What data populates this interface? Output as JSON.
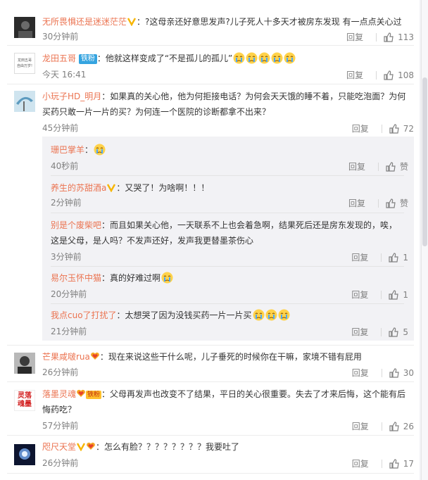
{
  "comments": [
    {
      "user": "无所畏惧还是迷迷茫茫",
      "text": "：?这母亲还好意思发声?儿子死人十多天才被房东发现 有一点点关心过",
      "time": "30分钟前",
      "reply": "回复",
      "likes": "113"
    },
    {
      "user": "龙田五哥",
      "badge": "铁粉",
      "text": "：他就这样变成了“不是孤儿的孤儿”",
      "time": "今天 16:41",
      "reply": "回复",
      "likes": "108",
      "avatar_text": [
        "龙田五哥",
        "自由万岁!"
      ]
    },
    {
      "user": "小玩子HD_明月",
      "text_lines": [
        "：如果真的关心他，他为何拒接电话？为何会天天饿的睡不着，只能吃泡面？为何",
        "买药只敢一片一片的买？为何连一个医院的诊断都拿不出来？"
      ],
      "time": "45分钟前",
      "reply": "回复",
      "likes": "72"
    }
  ],
  "replies": [
    {
      "user": "珊巴掌羊",
      "text": "：",
      "time": "40秒前",
      "reply": "回复",
      "likes": "赞"
    },
    {
      "user": "养生的苏甜酒a",
      "text": "：又哭了！为啥啊！！！",
      "time": "2分钟前",
      "reply": "回复",
      "likes": "赞"
    },
    {
      "user": "别是个废柴吧",
      "text_lines": [
        "：而且如果关心他，一天联系不上也会着急啊，结果死后还是房东发现的，唉，",
        "这是父母，是人吗？不发声还好，发声我更替墨茶伤心"
      ],
      "time": "3分钟前",
      "reply": "回复",
      "likes": "1"
    },
    {
      "user": "易尔玉怀中猫",
      "text": "：真的好难过啊",
      "time": "20分钟前",
      "reply": "回复",
      "likes": "1"
    },
    {
      "user": "我点cuo了打扰了",
      "text": "：太想哭了因为没钱买药一片一片买",
      "time": "21分钟前",
      "reply": "回复",
      "likes": "5"
    }
  ],
  "comments2": [
    {
      "user": "芒果咸啵rua",
      "text": "：现在来说这些干什么呢，儿子垂死的时候你在干嘛，家境不错有屁用",
      "time": "26分钟前",
      "reply": "回复",
      "likes": "30"
    },
    {
      "user": "落墨灵魂",
      "badge": "铁粉",
      "text_lines": [
        "：父母再发声也改变不了结果，平日的关心很重要。失去了才来后悔，这个能有后",
        "悔药吃？"
      ],
      "time": "57分钟前",
      "reply": "回复",
      "likes": "26",
      "avatar_text": [
        "灵落",
        "魂墨"
      ]
    },
    {
      "user": "咫尺天堂",
      "text": "：怎么有脸？？？？？？？？我要吐了",
      "time": "26分钟前",
      "reply": "回复",
      "likes": "17"
    }
  ],
  "colors": {
    "username": "#eb7350",
    "meta": "#808080",
    "reply_bg": "#f2f2f5"
  }
}
